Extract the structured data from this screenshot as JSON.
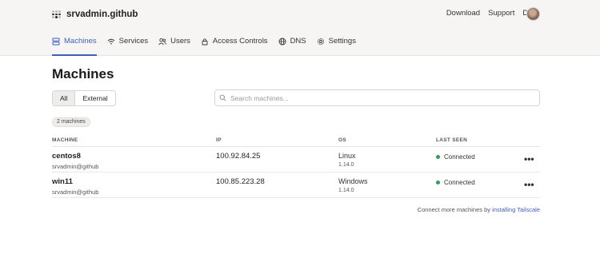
{
  "header": {
    "org_name": "srvadmin.github",
    "links": [
      "Download",
      "Support",
      "Docs"
    ]
  },
  "tabs": [
    {
      "label": "Machines",
      "icon": "server-icon",
      "active": true
    },
    {
      "label": "Services",
      "icon": "wifi-icon",
      "active": false
    },
    {
      "label": "Users",
      "icon": "users-icon",
      "active": false
    },
    {
      "label": "Access Controls",
      "icon": "lock-icon",
      "active": false
    },
    {
      "label": "DNS",
      "icon": "globe-icon",
      "active": false
    },
    {
      "label": "Settings",
      "icon": "gear-icon",
      "active": false
    }
  ],
  "page": {
    "title": "Machines",
    "filters": [
      "All",
      "External"
    ],
    "search_placeholder": "Search machines...",
    "count_label": "2 machines"
  },
  "table": {
    "columns": [
      "MACHINE",
      "IP",
      "OS",
      "LAST SEEN"
    ],
    "rows": [
      {
        "name": "centos8",
        "user": "srvadmin@github",
        "ip": "100.92.84.25",
        "os": "Linux",
        "version": "1.14.0",
        "status": "Connected"
      },
      {
        "name": "win11",
        "user": "srvadmin@github",
        "ip": "100.85.223.28",
        "os": "Windows",
        "version": "1.14.0",
        "status": "Connected"
      }
    ],
    "more_label": "•••"
  },
  "footer": {
    "text": "Connect more machines by ",
    "link": "installing Tailscale"
  },
  "colors": {
    "accent": "#3f5fbd",
    "connected": "#2f9d5c",
    "topbar_bg": "#f6f5f4"
  }
}
